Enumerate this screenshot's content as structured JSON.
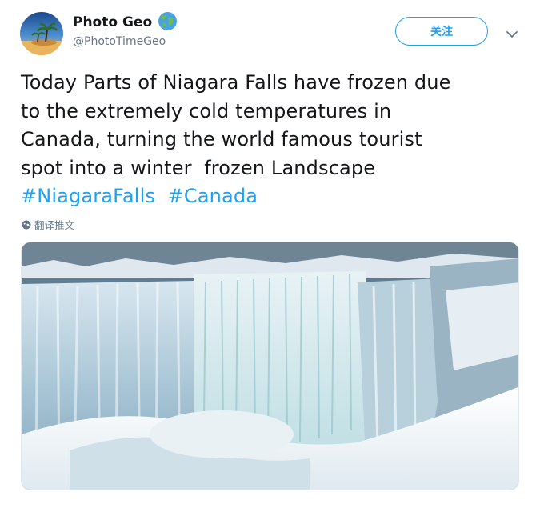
{
  "user": {
    "display_name": "Photo Geo",
    "handle": "@PhotoTimeGeo",
    "avatar_icon": "beach-palm-avatar",
    "badge_icon": "globe-emoji-icon"
  },
  "actions": {
    "follow_label": "关注",
    "menu_icon": "chevron-down-icon"
  },
  "tweet": {
    "lines": [
      "Today Parts of Niagara Falls have frozen due",
      "to the extremely cold temperatures in",
      "Canada, turning the world famous tourist",
      "spot into a winter  frozen Landscape"
    ],
    "hashtags": [
      "#NiagaraFalls",
      "#Canada"
    ],
    "translate_label": "翻译推文"
  },
  "media": {
    "image_icon": "frozen-waterfall-photo"
  },
  "colors": {
    "accent": "#1da1f2",
    "text": "#14171a",
    "muted": "#657786"
  }
}
